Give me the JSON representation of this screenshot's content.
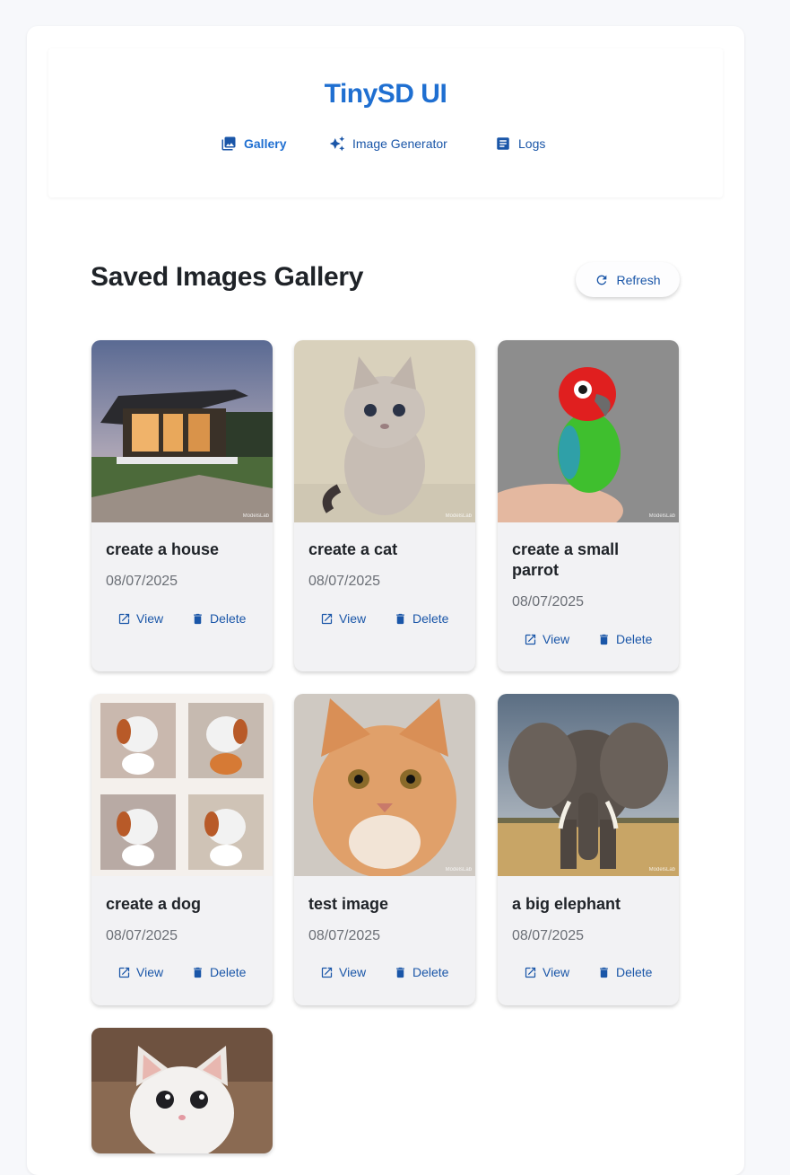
{
  "app": {
    "title": "TinySD UI"
  },
  "nav": {
    "items": [
      {
        "label": "Gallery",
        "icon": "image-icon",
        "active": true
      },
      {
        "label": "Image Generator",
        "icon": "sparkle-icon",
        "active": false
      },
      {
        "label": "Logs",
        "icon": "document-icon",
        "active": false
      }
    ]
  },
  "gallery": {
    "title": "Saved Images Gallery",
    "refresh_label": "Refresh",
    "watermark": "ModelsLab",
    "items": [
      {
        "title": "create a house",
        "date": "08/07/2025",
        "view_label": "View",
        "delete_label": "Delete"
      },
      {
        "title": "create a cat",
        "date": "08/07/2025",
        "view_label": "View",
        "delete_label": "Delete"
      },
      {
        "title": "create a small parrot",
        "date": "08/07/2025",
        "view_label": "View",
        "delete_label": "Delete"
      },
      {
        "title": "create a dog",
        "date": "08/07/2025",
        "view_label": "View",
        "delete_label": "Delete"
      },
      {
        "title": "test image",
        "date": "08/07/2025",
        "view_label": "View",
        "delete_label": "Delete"
      },
      {
        "title": "a big elephant",
        "date": "08/07/2025",
        "view_label": "View",
        "delete_label": "Delete"
      },
      {
        "title": "",
        "date": "",
        "view_label": "",
        "delete_label": ""
      }
    ]
  },
  "colors": {
    "accent": "#1f6fd1",
    "link": "#1a56a8",
    "card_bg": "#f2f2f4",
    "page_bg": "#f7f8fb"
  }
}
